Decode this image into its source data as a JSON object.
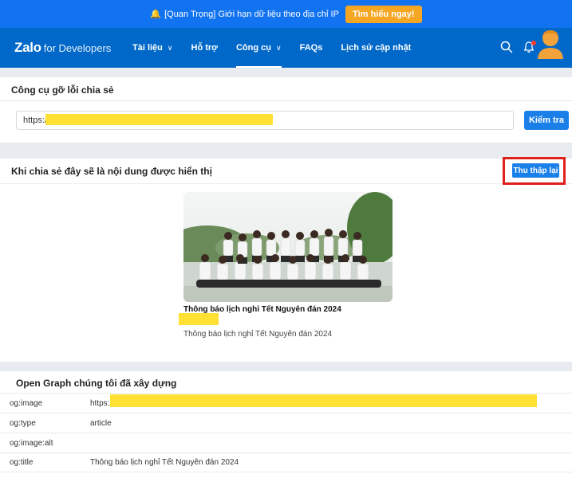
{
  "banner": {
    "text": "[Quan Trọng] Giới hạn dữ liệu theo địa chỉ IP",
    "cta_label": "Tìm hiểu ngay!"
  },
  "nav": {
    "logo_main": "Zalo",
    "logo_sub": "for Developers",
    "items": [
      {
        "label": "Tài liệu",
        "has_chevron": true
      },
      {
        "label": "Hỗ trợ",
        "has_chevron": false
      },
      {
        "label": "Công cụ",
        "has_chevron": true,
        "active": true
      },
      {
        "label": "FAQs",
        "has_chevron": false
      },
      {
        "label": "Lịch sử cập nhật",
        "has_chevron": false
      }
    ],
    "icons": [
      "search-icon",
      "bell-icon",
      "avatar"
    ]
  },
  "debug_card": {
    "title": "Công cụ gỡ lỗi chia sẻ",
    "url_value": "https://",
    "check_label": "Kiểm tra"
  },
  "preview_card": {
    "title": "Khi chia sẻ đây sẽ là nội dung được hiển thị",
    "recollect_label": "Thu thập lại",
    "share_title": "Thông báo lịch nghỉ Tết Nguyên đán 2024",
    "share_desc": "Thông báo lịch nghỉ Tết Nguyên đán 2024"
  },
  "og_card": {
    "title": "Open Graph chúng tôi đã xây dựng",
    "rows": [
      {
        "key": "og:image",
        "value": "https://"
      },
      {
        "key": "og:type",
        "value": "article"
      },
      {
        "key": "og:image:alt",
        "value": ""
      },
      {
        "key": "og:title",
        "value": "Thông báo lịch nghỉ Tết Nguyên đán 2024"
      }
    ]
  },
  "colors": {
    "banner_bg": "#1273f0",
    "nav_bg": "#0068c9",
    "accent_button": "#1a7fe8",
    "cta_orange": "#f5a623",
    "highlight_yellow": "#ffe033",
    "annotation_red": "#e0201a"
  }
}
